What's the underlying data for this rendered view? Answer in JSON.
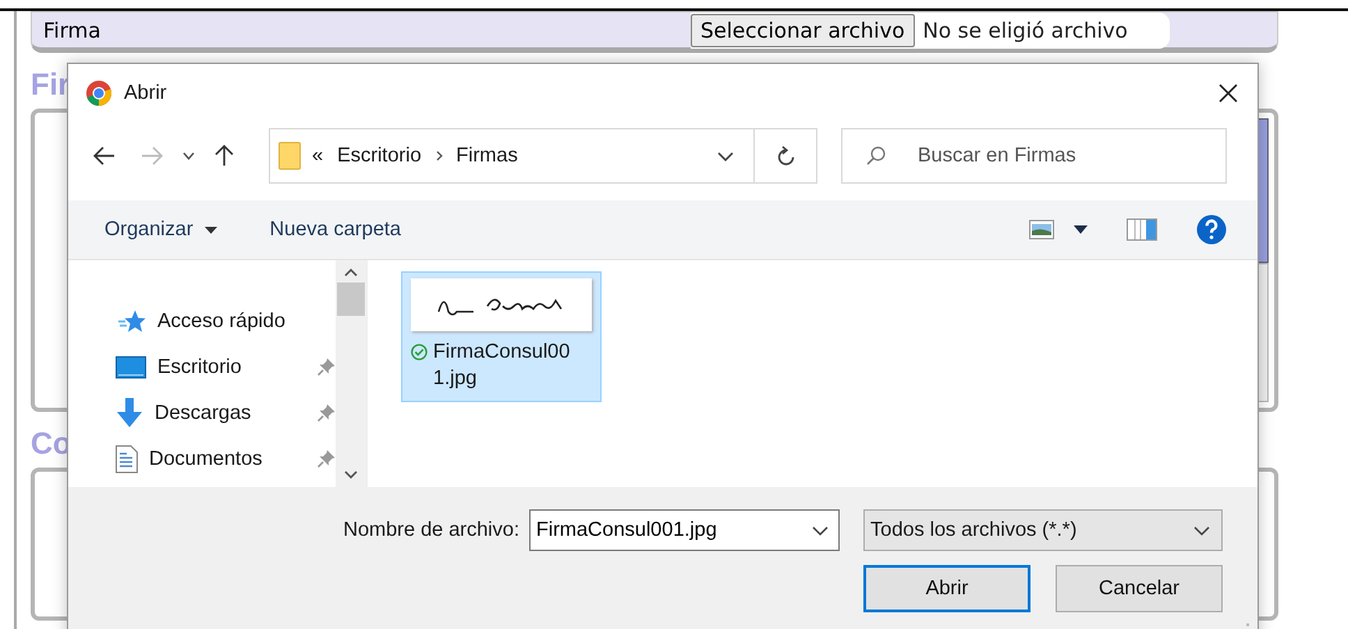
{
  "page": {
    "file_field": {
      "label": "Firma",
      "button": "Seleccionar archivo",
      "status": "No se eligió archivo"
    },
    "headings": [
      "Fir",
      "Co"
    ]
  },
  "dialog": {
    "title": "Abrir",
    "nav_buttons": [
      {
        "kind": "back",
        "disabled": false
      },
      {
        "kind": "forward",
        "disabled": true
      },
      {
        "kind": "recent",
        "disabled": false
      },
      {
        "kind": "up",
        "disabled": false
      }
    ],
    "breadcrumb": {
      "overflow": "«",
      "items": [
        "Escritorio",
        "Firmas"
      ]
    },
    "search": {
      "placeholder": "Buscar en Firmas"
    },
    "toolbar": {
      "organize": "Organizar",
      "new_folder": "Nueva carpeta"
    },
    "nav_items": [
      {
        "label": "Acceso rápido",
        "kind": "quick",
        "pinned": false
      },
      {
        "label": "Escritorio",
        "kind": "desktop",
        "pinned": true
      },
      {
        "label": "Descargas",
        "kind": "downloads",
        "pinned": true
      },
      {
        "label": "Documentos",
        "kind": "documents",
        "pinned": true
      }
    ],
    "files": [
      {
        "name": "FirmaConsul001.jpg",
        "selected": true
      }
    ],
    "filename_label": "Nombre de archivo:",
    "filename_value": "FirmaConsul001.jpg",
    "filter": "Todos los archivos (*.*)",
    "buttons": [
      {
        "label": "Abrir",
        "kind": "default"
      },
      {
        "label": "Cancelar",
        "kind": "normal"
      }
    ]
  }
}
